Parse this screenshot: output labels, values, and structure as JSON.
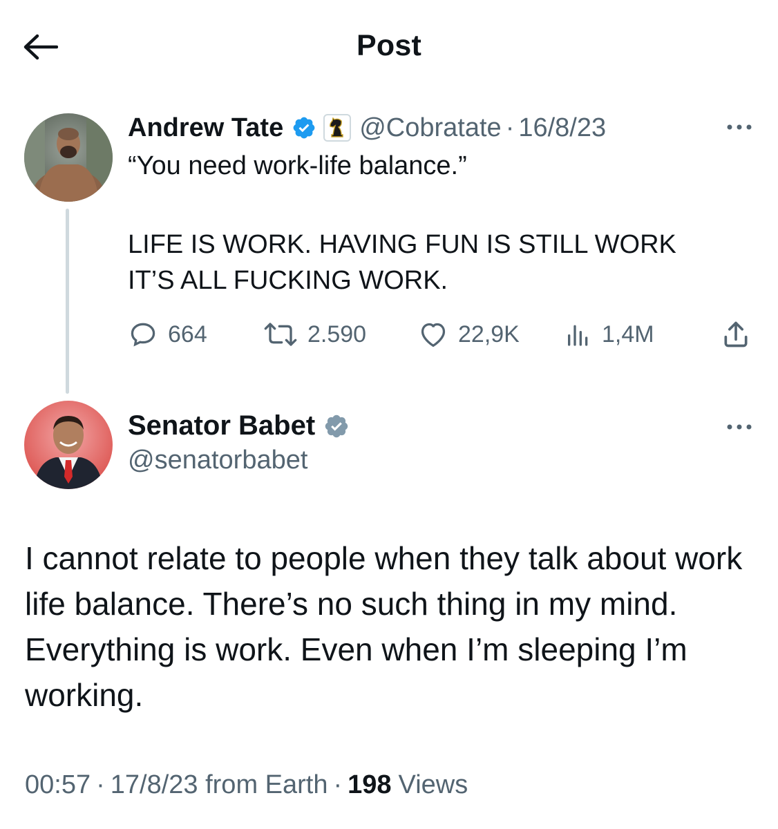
{
  "header": {
    "title": "Post"
  },
  "quoted_post": {
    "author_name": "Andrew Tate",
    "handle": "@Cobratate",
    "separator": "·",
    "date": "16/8/23",
    "lines": [
      "“You need work-life balance.”",
      "LIFE IS WORK. HAVING FUN IS STILL WORK\nIT’S ALL FUCKING WORK."
    ],
    "stats": {
      "replies": "664",
      "reposts": "2.590",
      "likes": "22,9K",
      "views": "1,4M"
    },
    "icons": [
      "verified-badge-icon",
      "knight-chess-icon",
      "more-dots-icon",
      "reply-icon",
      "repost-icon",
      "like-heart-icon",
      "views-bars-icon",
      "share-icon"
    ]
  },
  "main_post": {
    "author_name": "Senator Babet",
    "handle": "@senatorbabet",
    "text": "I cannot relate to people when they talk about work life balance. There’s no such thing in my mind. Everything is work. Even when I’m sleeping I’m working.",
    "time": "00:57",
    "sep1": "·",
    "date": "17/8/23 from Earth",
    "sep2": "·",
    "views_count": "198",
    "views_label": "Views"
  },
  "colors": {
    "text": "#0f1419",
    "secondary": "#536471",
    "verified_blue": "#1d9bf0",
    "verified_gray": "#829aab",
    "thread_line": "#cfd9de"
  }
}
